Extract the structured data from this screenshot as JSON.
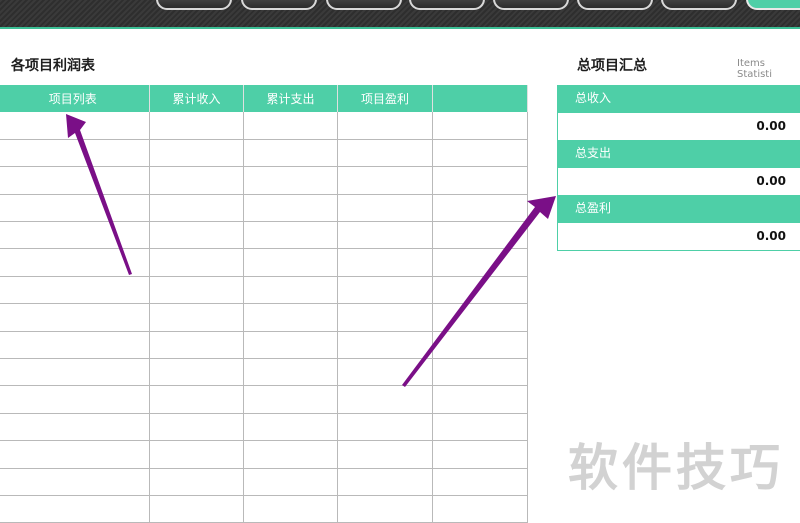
{
  "topbar": {
    "tabs": [
      {
        "label": "",
        "active": false
      },
      {
        "label": "",
        "active": false
      },
      {
        "label": "",
        "active": false
      },
      {
        "label": "",
        "active": false
      },
      {
        "label": "",
        "active": false
      },
      {
        "label": "",
        "active": false
      },
      {
        "label": "",
        "active": false
      },
      {
        "label": "",
        "active": true
      }
    ]
  },
  "left": {
    "title": "各项目利润表",
    "columns": [
      "项目列表",
      "累计收入",
      "累计支出",
      "项目盈利",
      ""
    ]
  },
  "right": {
    "title": "总项目汇总",
    "subtitle": "Items Statisti",
    "rows": [
      {
        "label": "总收入",
        "value": "0.00"
      },
      {
        "label": "总支出",
        "value": "0.00"
      },
      {
        "label": "总盈利",
        "value": "0.00"
      }
    ]
  },
  "watermark": "软件技巧",
  "colors": {
    "accent": "#4ecfa7",
    "arrow": "#7a0f87",
    "topbar": "#333333"
  }
}
